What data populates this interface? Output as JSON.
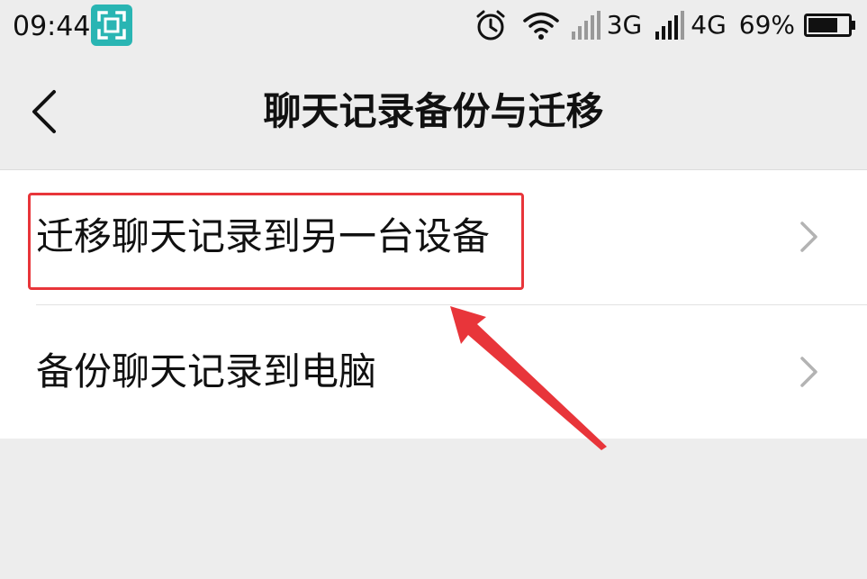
{
  "status_bar": {
    "time": "09:44",
    "network_3g": "3G",
    "network_4g": "4G",
    "battery": "69%"
  },
  "header": {
    "title": "聊天记录备份与迁移"
  },
  "list": {
    "items": [
      {
        "label": "迁移聊天记录到另一台设备"
      },
      {
        "label": "备份聊天记录到电脑"
      }
    ]
  },
  "colors": {
    "background": "#ededed",
    "list_background": "#ffffff",
    "annotation_red": "#e8353a",
    "scan_icon_teal": "#29b5b3"
  },
  "icons": {
    "status": [
      "scan-icon",
      "alarm-icon",
      "wifi-icon",
      "signal-icon",
      "battery-icon"
    ],
    "navigation": [
      "back-arrow-icon",
      "chevron-right-icon"
    ]
  }
}
